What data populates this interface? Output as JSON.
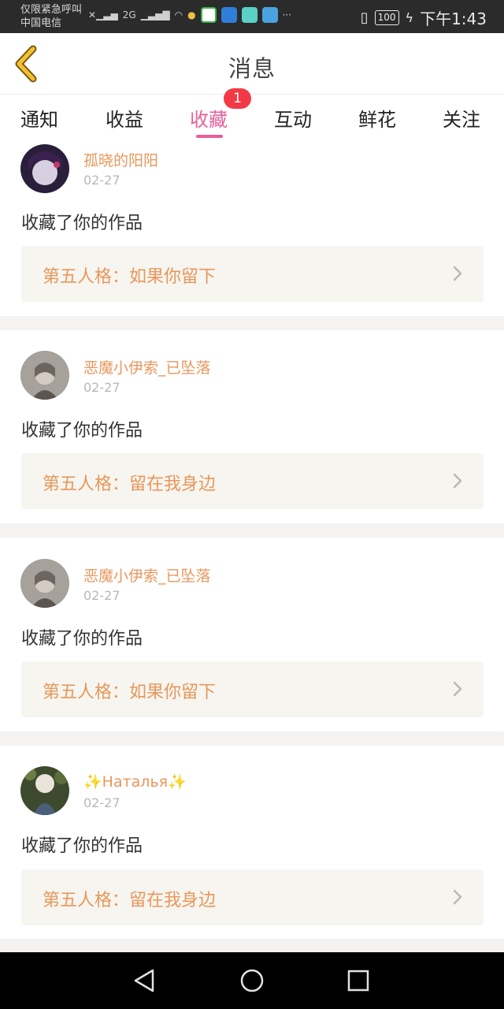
{
  "status_bar": {
    "line1": "仅限紧急呼叫",
    "line2": "中国电信",
    "network": "2G",
    "battery": "100",
    "time": "下午1:43",
    "more": "···"
  },
  "header": {
    "title": "消息"
  },
  "tabs": [
    {
      "label": "通知"
    },
    {
      "label": "收益"
    },
    {
      "label": "收藏",
      "badge": "1",
      "active": true
    },
    {
      "label": "互动"
    },
    {
      "label": "鲜花"
    },
    {
      "label": "关注"
    }
  ],
  "items": [
    {
      "user": "孤晓的阳阳",
      "date": "02-27",
      "action": "收藏了你的作品",
      "work": "第五人格：如果你留下"
    },
    {
      "user": "恶魔小伊索_已坠落",
      "date": "02-27",
      "action": "收藏了你的作品",
      "work": "第五人格：留在我身边"
    },
    {
      "user": "恶魔小伊索_已坠落",
      "date": "02-27",
      "action": "收藏了你的作品",
      "work": "第五人格：如果你留下"
    },
    {
      "user": "✨Наталья✨",
      "date": "02-27",
      "action": "收藏了你的作品",
      "work": "第五人格：留在我身边"
    }
  ],
  "colors": {
    "accent": "#e85f9a",
    "name": "#e8975c",
    "badge": "#f23a46",
    "back": "#e5b52a"
  }
}
